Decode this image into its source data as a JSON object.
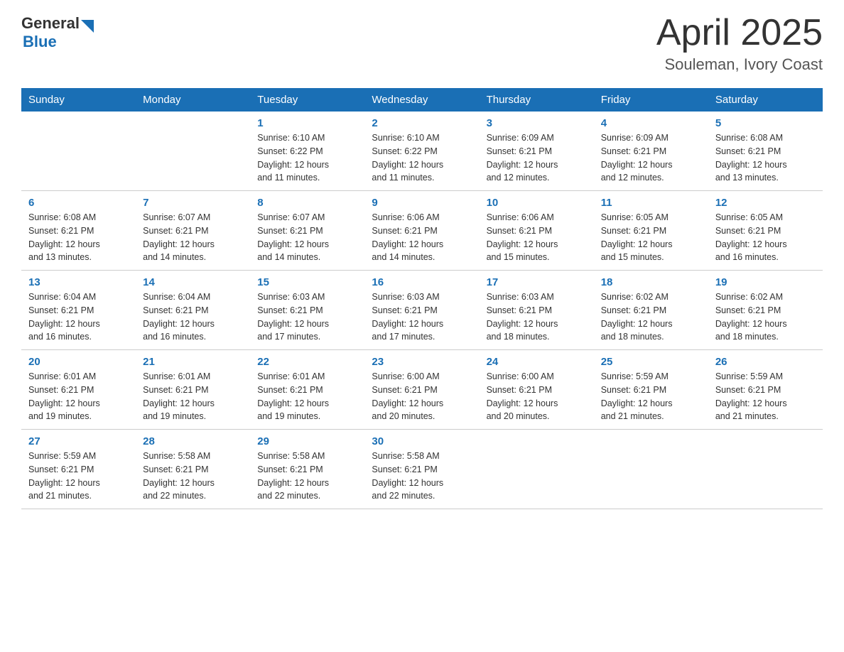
{
  "header": {
    "logo_general": "General",
    "logo_blue": "Blue",
    "month_title": "April 2025",
    "location": "Souleman, Ivory Coast"
  },
  "days_of_week": [
    "Sunday",
    "Monday",
    "Tuesday",
    "Wednesday",
    "Thursday",
    "Friday",
    "Saturday"
  ],
  "weeks": [
    [
      {
        "day": "",
        "info": ""
      },
      {
        "day": "",
        "info": ""
      },
      {
        "day": "1",
        "info": "Sunrise: 6:10 AM\nSunset: 6:22 PM\nDaylight: 12 hours\nand 11 minutes."
      },
      {
        "day": "2",
        "info": "Sunrise: 6:10 AM\nSunset: 6:22 PM\nDaylight: 12 hours\nand 11 minutes."
      },
      {
        "day": "3",
        "info": "Sunrise: 6:09 AM\nSunset: 6:21 PM\nDaylight: 12 hours\nand 12 minutes."
      },
      {
        "day": "4",
        "info": "Sunrise: 6:09 AM\nSunset: 6:21 PM\nDaylight: 12 hours\nand 12 minutes."
      },
      {
        "day": "5",
        "info": "Sunrise: 6:08 AM\nSunset: 6:21 PM\nDaylight: 12 hours\nand 13 minutes."
      }
    ],
    [
      {
        "day": "6",
        "info": "Sunrise: 6:08 AM\nSunset: 6:21 PM\nDaylight: 12 hours\nand 13 minutes."
      },
      {
        "day": "7",
        "info": "Sunrise: 6:07 AM\nSunset: 6:21 PM\nDaylight: 12 hours\nand 14 minutes."
      },
      {
        "day": "8",
        "info": "Sunrise: 6:07 AM\nSunset: 6:21 PM\nDaylight: 12 hours\nand 14 minutes."
      },
      {
        "day": "9",
        "info": "Sunrise: 6:06 AM\nSunset: 6:21 PM\nDaylight: 12 hours\nand 14 minutes."
      },
      {
        "day": "10",
        "info": "Sunrise: 6:06 AM\nSunset: 6:21 PM\nDaylight: 12 hours\nand 15 minutes."
      },
      {
        "day": "11",
        "info": "Sunrise: 6:05 AM\nSunset: 6:21 PM\nDaylight: 12 hours\nand 15 minutes."
      },
      {
        "day": "12",
        "info": "Sunrise: 6:05 AM\nSunset: 6:21 PM\nDaylight: 12 hours\nand 16 minutes."
      }
    ],
    [
      {
        "day": "13",
        "info": "Sunrise: 6:04 AM\nSunset: 6:21 PM\nDaylight: 12 hours\nand 16 minutes."
      },
      {
        "day": "14",
        "info": "Sunrise: 6:04 AM\nSunset: 6:21 PM\nDaylight: 12 hours\nand 16 minutes."
      },
      {
        "day": "15",
        "info": "Sunrise: 6:03 AM\nSunset: 6:21 PM\nDaylight: 12 hours\nand 17 minutes."
      },
      {
        "day": "16",
        "info": "Sunrise: 6:03 AM\nSunset: 6:21 PM\nDaylight: 12 hours\nand 17 minutes."
      },
      {
        "day": "17",
        "info": "Sunrise: 6:03 AM\nSunset: 6:21 PM\nDaylight: 12 hours\nand 18 minutes."
      },
      {
        "day": "18",
        "info": "Sunrise: 6:02 AM\nSunset: 6:21 PM\nDaylight: 12 hours\nand 18 minutes."
      },
      {
        "day": "19",
        "info": "Sunrise: 6:02 AM\nSunset: 6:21 PM\nDaylight: 12 hours\nand 18 minutes."
      }
    ],
    [
      {
        "day": "20",
        "info": "Sunrise: 6:01 AM\nSunset: 6:21 PM\nDaylight: 12 hours\nand 19 minutes."
      },
      {
        "day": "21",
        "info": "Sunrise: 6:01 AM\nSunset: 6:21 PM\nDaylight: 12 hours\nand 19 minutes."
      },
      {
        "day": "22",
        "info": "Sunrise: 6:01 AM\nSunset: 6:21 PM\nDaylight: 12 hours\nand 19 minutes."
      },
      {
        "day": "23",
        "info": "Sunrise: 6:00 AM\nSunset: 6:21 PM\nDaylight: 12 hours\nand 20 minutes."
      },
      {
        "day": "24",
        "info": "Sunrise: 6:00 AM\nSunset: 6:21 PM\nDaylight: 12 hours\nand 20 minutes."
      },
      {
        "day": "25",
        "info": "Sunrise: 5:59 AM\nSunset: 6:21 PM\nDaylight: 12 hours\nand 21 minutes."
      },
      {
        "day": "26",
        "info": "Sunrise: 5:59 AM\nSunset: 6:21 PM\nDaylight: 12 hours\nand 21 minutes."
      }
    ],
    [
      {
        "day": "27",
        "info": "Sunrise: 5:59 AM\nSunset: 6:21 PM\nDaylight: 12 hours\nand 21 minutes."
      },
      {
        "day": "28",
        "info": "Sunrise: 5:58 AM\nSunset: 6:21 PM\nDaylight: 12 hours\nand 22 minutes."
      },
      {
        "day": "29",
        "info": "Sunrise: 5:58 AM\nSunset: 6:21 PM\nDaylight: 12 hours\nand 22 minutes."
      },
      {
        "day": "30",
        "info": "Sunrise: 5:58 AM\nSunset: 6:21 PM\nDaylight: 12 hours\nand 22 minutes."
      },
      {
        "day": "",
        "info": ""
      },
      {
        "day": "",
        "info": ""
      },
      {
        "day": "",
        "info": ""
      }
    ]
  ]
}
